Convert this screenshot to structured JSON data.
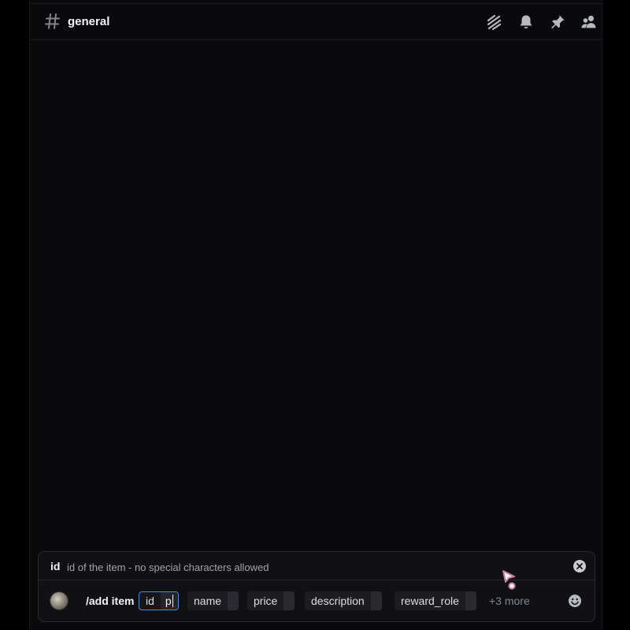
{
  "channel": {
    "name": "general",
    "hash_icon": "hash-icon"
  },
  "header_icons": [
    "threads-icon",
    "bell-icon",
    "pin-icon",
    "members-icon"
  ],
  "command_hint": {
    "option_name": "id",
    "option_description": "id of the item - no special characters allowed"
  },
  "composer": {
    "command": "/add item",
    "options": [
      {
        "label": "id",
        "value": "p",
        "active": true
      },
      {
        "label": "name",
        "value": "",
        "active": false
      },
      {
        "label": "price",
        "value": "",
        "active": false
      },
      {
        "label": "description",
        "value": "",
        "active": false
      },
      {
        "label": "reward_role",
        "value": "",
        "active": false
      }
    ],
    "more_label": "+3 more"
  },
  "colors": {
    "background": "#0a0a0c",
    "accent_focus": "#4a8cd9",
    "cursor_pink": "#e4a9c0"
  }
}
